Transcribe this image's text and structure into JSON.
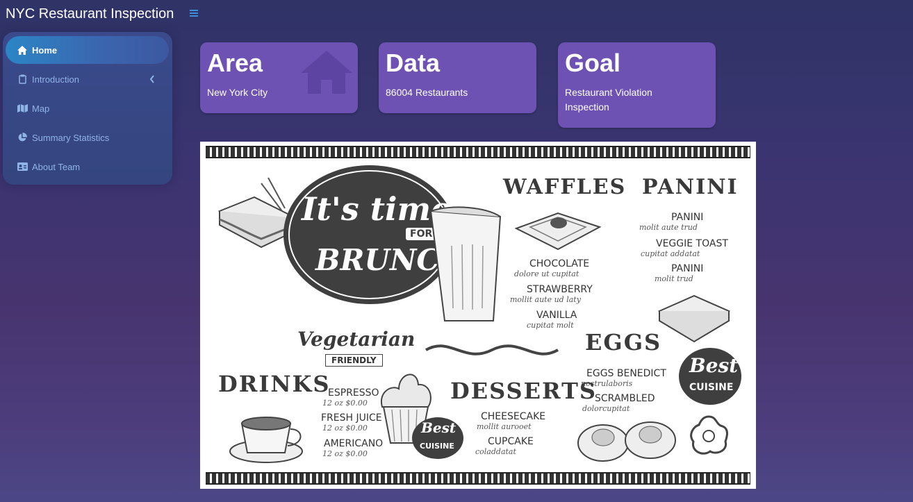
{
  "app": {
    "title": "NYC Restaurant Inspection"
  },
  "sidebar": {
    "items": [
      {
        "label": "Home",
        "icon": "home-icon",
        "active": true
      },
      {
        "label": "Introduction",
        "icon": "clipboard-icon",
        "has_chevron": true
      },
      {
        "label": "Map",
        "icon": "map-icon"
      },
      {
        "label": "Summary Statistics",
        "icon": "pie-chart-icon"
      },
      {
        "label": "About Team",
        "icon": "id-card-icon"
      }
    ]
  },
  "cards": [
    {
      "title": "Area",
      "subtitle": "New York City",
      "icon": "home-icon"
    },
    {
      "title": "Data",
      "subtitle": "86004 Restaurants"
    },
    {
      "title": "Goal",
      "subtitle": "Restaurant Violation Inspection"
    }
  ],
  "menu_image": {
    "headline_1": "It's time",
    "headline_for": "FOR",
    "headline_2": "BRUNCH",
    "waffles": "WAFFLES",
    "waffle_items": [
      {
        "name": "CHOCOLATE",
        "desc": "dolore ut cupitat"
      },
      {
        "name": "STRAWBERRY",
        "desc": "mollit aute ud laty"
      },
      {
        "name": "VANILLA",
        "desc": "cupitat molt"
      }
    ],
    "panini": "PANINI",
    "panini_items": [
      {
        "name": "PANINI",
        "desc": "molit aute trud"
      },
      {
        "name": "VEGGIE TOAST",
        "desc": "cupitat addatat"
      },
      {
        "name": "PANINI",
        "desc": "molit trud"
      }
    ],
    "vegetarian": "Vegetarian",
    "friendly": "FRIENDLY",
    "eggs": "EGGS",
    "egg_items": [
      {
        "name": "EGGS BENEDICT",
        "desc": "nostrulaboris"
      },
      {
        "name": "SCRAMBLED",
        "desc": "dolorcupitat"
      }
    ],
    "drinks": "DRINKS",
    "drink_items": [
      {
        "name": "ESPRESSO",
        "price": "12 oz $0.00"
      },
      {
        "name": "FRESH JUICE",
        "price": "12 oz $0.00"
      },
      {
        "name": "AMERICANO",
        "price": "12 oz $0.00"
      }
    ],
    "desserts": "DESSERTS",
    "dessert_items": [
      {
        "name": "CHEESECAKE",
        "desc": "mollit aurooet"
      },
      {
        "name": "CUPCAKE",
        "desc": "coladdatat"
      }
    ],
    "best": "Best",
    "cuisine": "CUISINE"
  }
}
